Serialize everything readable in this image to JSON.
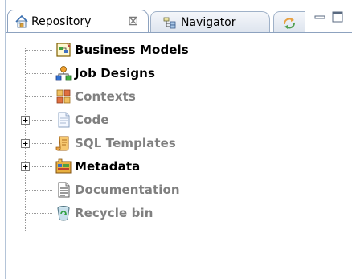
{
  "tabs": [
    {
      "label": "Repository",
      "icon": "repository-house-icon",
      "active": true,
      "close_glyph": "⊠"
    },
    {
      "label": "Navigator",
      "icon": "navigator-tree-icon",
      "active": false
    },
    {
      "label": "",
      "icon": "synchronize-arrows-icon",
      "active": false
    }
  ],
  "controls": {
    "minimize": "minimize-icon",
    "maximize": "maximize-icon"
  },
  "tree": {
    "items": [
      {
        "label": "Business Models",
        "icon": "business-models-icon",
        "expandable": false,
        "enabled": true
      },
      {
        "label": "Job Designs",
        "icon": "job-designs-icon",
        "expandable": false,
        "enabled": true
      },
      {
        "label": "Contexts",
        "icon": "contexts-icon",
        "expandable": false,
        "enabled": false
      },
      {
        "label": "Code",
        "icon": "code-document-icon",
        "expandable": true,
        "enabled": false
      },
      {
        "label": "SQL Templates",
        "icon": "sql-templates-scroll-icon",
        "expandable": true,
        "enabled": false
      },
      {
        "label": "Metadata",
        "icon": "metadata-icon",
        "expandable": true,
        "enabled": true
      },
      {
        "label": "Documentation",
        "icon": "documentation-icon",
        "expandable": false,
        "enabled": false
      },
      {
        "label": "Recycle bin",
        "icon": "recycle-bin-icon",
        "expandable": false,
        "enabled": false
      }
    ]
  },
  "colors": {
    "enabled_text": "#000000",
    "disabled_text": "#808080",
    "tab_border": "#8da2bf"
  }
}
